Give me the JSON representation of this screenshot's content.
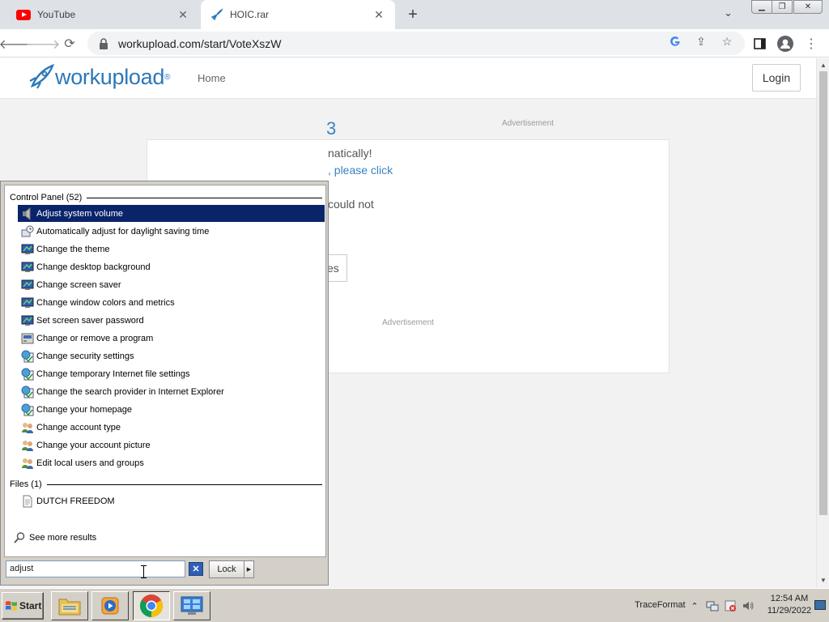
{
  "browser": {
    "tabs": [
      {
        "title": "YouTube",
        "icon": "youtube-icon",
        "active": false
      },
      {
        "title": "HOIC.rar",
        "icon": "rocket-icon",
        "active": true
      }
    ],
    "new_tab_symbol": "+",
    "url": "workupload.com/start/VoteXszW"
  },
  "site": {
    "brand": "workupload",
    "trademark": "®",
    "nav_home": "Home",
    "login": "Login",
    "ad_label": "Advertisement",
    "peek": {
      "number_fragment": "3",
      "line1": "natically!",
      "line2": ", please click",
      "line3": "could not",
      "button": "es"
    }
  },
  "start_menu": {
    "control_panel_header": "Control Panel (52)",
    "control_panel_items": [
      {
        "label": "Adjust system volume",
        "icon": "speaker-icon",
        "selected": true
      },
      {
        "label": "Automatically adjust for daylight saving time",
        "icon": "clock-globe-icon",
        "selected": false
      },
      {
        "label": "Change the theme",
        "icon": "display-icon",
        "selected": false
      },
      {
        "label": "Change desktop background",
        "icon": "display-icon",
        "selected": false
      },
      {
        "label": "Change screen saver",
        "icon": "display-icon",
        "selected": false
      },
      {
        "label": "Change window colors and metrics",
        "icon": "display-icon",
        "selected": false
      },
      {
        "label": "Set screen saver password",
        "icon": "display-icon",
        "selected": false
      },
      {
        "label": "Change or remove a program",
        "icon": "programs-icon",
        "selected": false
      },
      {
        "label": "Change security settings",
        "icon": "internet-options-icon",
        "selected": false
      },
      {
        "label": "Change temporary Internet file settings",
        "icon": "internet-options-icon",
        "selected": false
      },
      {
        "label": "Change the search provider in Internet Explorer",
        "icon": "internet-options-icon",
        "selected": false
      },
      {
        "label": "Change your homepage",
        "icon": "internet-options-icon",
        "selected": false
      },
      {
        "label": "Change account type",
        "icon": "users-icon",
        "selected": false
      },
      {
        "label": "Change your account picture",
        "icon": "users-icon",
        "selected": false
      },
      {
        "label": "Edit local users and groups",
        "icon": "users-icon",
        "selected": false
      }
    ],
    "files_header": "Files (1)",
    "file_items": [
      {
        "label": "DUTCH FREEDOM",
        "icon": "document-icon"
      }
    ],
    "see_more": "See more results",
    "search_value": "adjust",
    "lock_label": "Lock"
  },
  "taskbar": {
    "start_label": "Start",
    "apps": [
      "explorer-icon",
      "media-player-icon",
      "chrome-icon",
      "control-panel-icon"
    ],
    "tray_label": "TraceFormat",
    "time": "12:54 AM",
    "date": "11/29/2022"
  },
  "colors": {
    "selection": "#0a246a",
    "brand_blue": "#2c78b8",
    "taskbar": "#d4d0c8"
  }
}
